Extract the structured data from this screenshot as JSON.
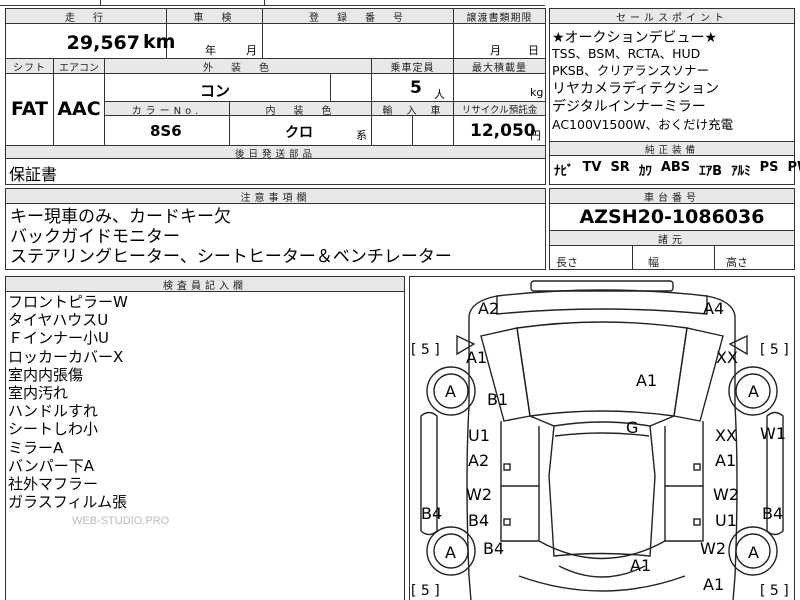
{
  "top_header": {
    "mileage_label": "走　行",
    "inspection_label": "車　検",
    "reg_number_label": "登　録　番　号",
    "transfer_deadline_label": "譲渡書類期限",
    "sales_point_label": "セールスポイント"
  },
  "mileage": {
    "value": "29,567",
    "unit": "km"
  },
  "inspection": {
    "year_unit": "年",
    "month_unit": "月"
  },
  "transfer": {
    "month_unit": "月",
    "day_unit": "日"
  },
  "row2_header": {
    "shift_label": "シフト",
    "aircon_label": "エアコン",
    "exterior_color_label": "外　装　色",
    "capacity_label": "乗車定員",
    "max_load_label": "最大積載量"
  },
  "shift": "FAT",
  "aircon": "AAC",
  "exterior_color": "コン",
  "capacity": {
    "value": "5",
    "unit": "人"
  },
  "max_load": {
    "unit": "kg"
  },
  "row3_header": {
    "color_no_label": "カラーNo.",
    "interior_color_label": "内　装　色",
    "import_label": "輸　入　車",
    "recycle_label": "リサイクル預託金"
  },
  "color_no": "8S6",
  "interior_color": {
    "value": "クロ",
    "suffix": "系"
  },
  "recycle": {
    "value": "12,050",
    "unit": "円"
  },
  "later_parts": {
    "label": "後日発送部品",
    "value": "保証書"
  },
  "sales_points": [
    "★オークションデビュー★",
    "TSS、BSM、RCTA、HUD",
    "PKSB、クリアランスソナー",
    "リヤカメラディテクション",
    "デジタルインナーミラー",
    "AC100V1500W、おくだけ充電"
  ],
  "equipment": {
    "label": "純正装備",
    "items": [
      "ﾅﾋﾞ",
      "TV",
      "SR",
      "ｶﾜ",
      "ABS",
      "ｴｱB",
      "ｱﾙﾐ",
      "PS",
      "PW"
    ]
  },
  "notes": {
    "label": "注意事項欄",
    "lines": [
      "キー現車のみ、カードキー欠",
      "バックガイドモニター",
      "ステアリングヒーター、シートヒーター＆ベンチレーター"
    ]
  },
  "chassis": {
    "label": "車台番号",
    "value": "AZSH20-1086036"
  },
  "dims": {
    "label": "諸元",
    "length": "長さ",
    "width": "幅",
    "height": "高さ"
  },
  "inspector": {
    "label": "検査員記入欄",
    "lines": [
      "フロントピラーW",
      "タイヤハウスU",
      "Ｆインナー小U",
      "ロッカーカバーX",
      "室内内張傷",
      "室内汚れ",
      "ハンドルすれ",
      "シートしわ小",
      "ミラーA",
      "バンパー下A",
      "社外マフラー",
      "ガラスフィルム張"
    ]
  },
  "watermark": "WEB-STUDIO.PRO",
  "damage_map": {
    "tire_depth": [
      "5",
      "5",
      "5",
      "5"
    ],
    "marks": {
      "fl_corner": "A2",
      "fr_corner": "A4",
      "l_fender": "A1",
      "r_fender": "XX",
      "fl_tire": "A",
      "fr_tire": "A",
      "rl_tire": "A",
      "rr_tire": "A",
      "l_pillar": "B1",
      "hood": "A1",
      "roof": "G",
      "l_front_door_upper": "U1",
      "l_front_door_lower": "A2",
      "r_front_door_upper": "XX",
      "r_front_door_lower": "A1",
      "r_side": "W1",
      "l_rear_door_upper": "W2",
      "l_rear_door_lower": "B4",
      "r_rear_door_upper": "W2",
      "r_rear_door_lower": "U1",
      "l_rocker": "B4",
      "r_rocker": "B4",
      "l_rear_fender": "B4",
      "r_rear_fender": "W2",
      "trunk": "A1",
      "rear_bumper_right": "A1"
    }
  }
}
